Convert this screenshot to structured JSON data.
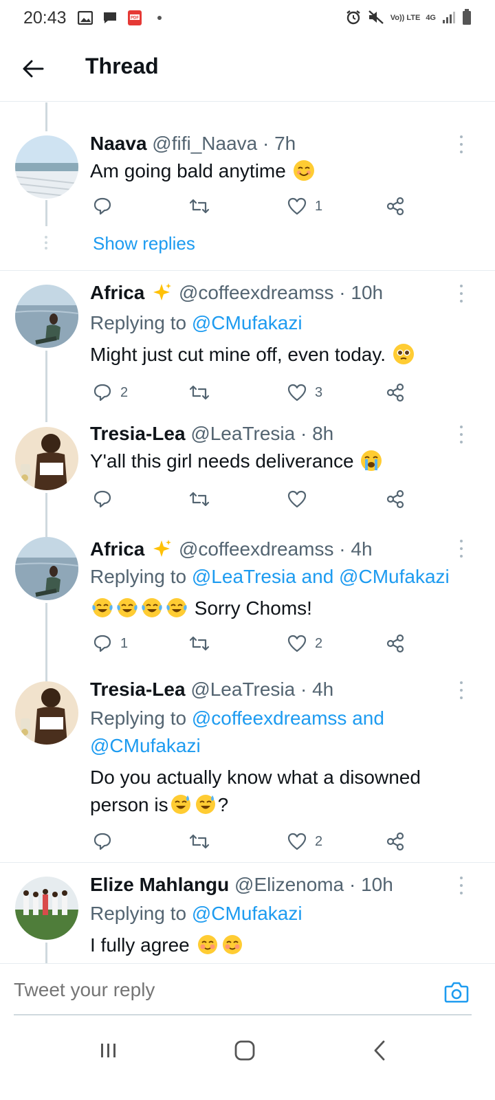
{
  "status_bar": {
    "time": "20:43",
    "icons_left": [
      "image-icon",
      "message-icon",
      "pdf-icon",
      "dot-icon"
    ],
    "volte": "Vo)) LTE",
    "network": "4G",
    "icons_right": [
      "alarm-icon",
      "mute-icon",
      "signal-icon",
      "battery-icon"
    ]
  },
  "header": {
    "title": "Thread"
  },
  "tweets": [
    {
      "name": "Naava",
      "handle": "@fifi_Naava · 7h",
      "text": "Am going bald anytime",
      "emojis": [
        "smiling-face"
      ],
      "replies": "",
      "likes": "1"
    },
    {
      "name": "Africa",
      "handle": "@coffeexdreamss · 10h",
      "replying_prefix": "Replying to ",
      "replying_to": "@CMufakazi",
      "text": "Might just cut mine off, even today.",
      "emojis": [
        "pleading-face"
      ],
      "replies": "2",
      "likes": "3"
    },
    {
      "name": "Tresia-Lea",
      "handle": "@LeaTresia · 8h",
      "text": "Y'all  this girl needs deliverance",
      "emojis": [
        "crying-face"
      ],
      "replies": "",
      "likes": ""
    },
    {
      "name": "Africa",
      "handle": "@coffeexdreamss · 4h",
      "replying_prefix": "Replying to ",
      "replying_to": "@LeaTresia and @CMufakazi",
      "text": "Sorry Choms!",
      "emojis": [
        "tears-of-joy",
        "tears-of-joy",
        "tears-of-joy",
        "tears-of-joy"
      ],
      "replies": "1",
      "likes": "2"
    },
    {
      "name": "Tresia-Lea",
      "handle": "@LeaTresia · 4h",
      "replying_prefix": "Replying to ",
      "replying_to": "@coffeexdreamss and",
      "replying_to_2": "@CMufakazi",
      "text_line1": "Do you actually know what a disowned",
      "text_line2_a": "person  is",
      "text_line2_b": "?",
      "emojis": [
        "sweat-smile",
        "sweat-smile"
      ],
      "replies": "",
      "likes": "2"
    },
    {
      "name": "Elize Mahlangu",
      "handle": "@Elizenoma · 10h",
      "replying_prefix": "Replying to ",
      "replying_to": "@CMufakazi",
      "text": "I fully agree",
      "emojis": [
        "blushing-face",
        "blushing-face"
      ]
    }
  ],
  "show_replies": "Show replies",
  "composer": {
    "placeholder": "Tweet your reply"
  },
  "colors": {
    "accent": "#1d9bf0",
    "text": "#0f1419",
    "muted": "#536471",
    "border": "#e6ecf0"
  }
}
